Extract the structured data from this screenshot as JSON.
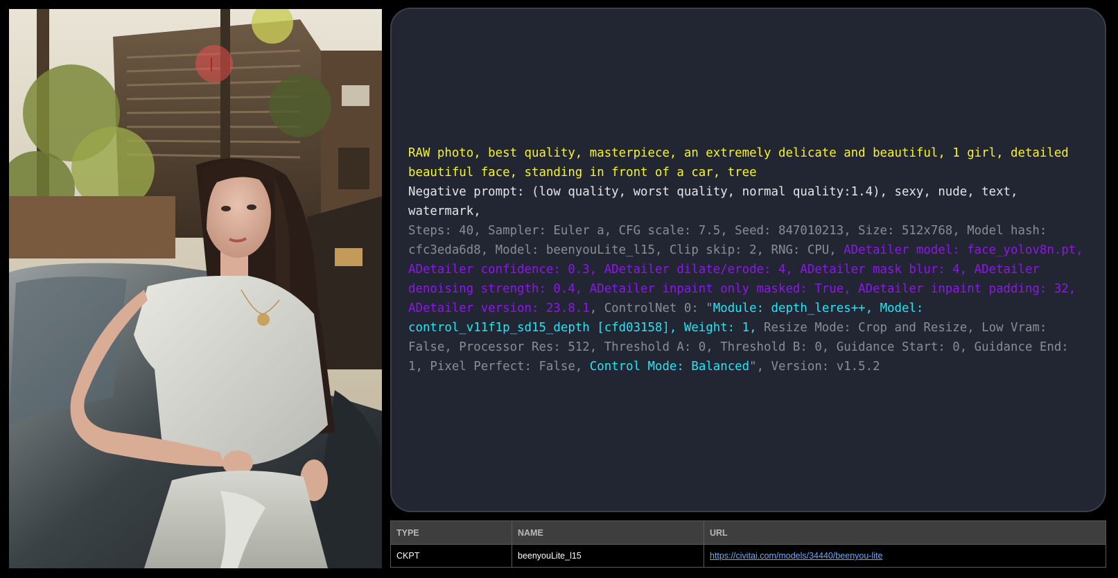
{
  "prompt": {
    "positive": "RAW photo, best quality, masterpiece, an extremely delicate and beautiful, 1 girl, detailed beautiful face, standing in front of a car, tree",
    "negative": "Negative prompt: (low quality, worst quality, normal quality:1.4), sexy, nude, text, watermark,",
    "params": {
      "base": "Steps: 40, Sampler: Euler a, CFG scale: 7.5, Seed: 847010213, Size: 512x768, Model hash: cfc3eda6d8, Model: beenyouLite_l15, Clip skip: 2, RNG: CPU, ",
      "adetailer": "ADetailer model: face_yolov8n.pt, ADetailer confidence: 0.3, ADetailer dilate/erode: 4, ADetailer mask blur: 4, ADetailer denoising strength: 0.4, ADetailer inpaint only masked: True, ADetailer inpaint padding: 32, ADetailer version: 23.8.1",
      "controlnet_prefix": ", ControlNet 0: \"",
      "controlnet_module": "Module: depth_leres++, Model: control_v11f1p_sd15_depth [cfd03158], Weight: 1,",
      "controlnet_settings": " Resize Mode: Crop and Resize, Low Vram: False, Processor Res: 512, Threshold A: 0, Threshold B: 0, Guidance Start: 0, Guidance End: 1, Pixel Perfect: False, ",
      "control_mode": "Control Mode: Balanced",
      "version_suffix": "\", Version: v1.5.2"
    }
  },
  "resources": {
    "headers": {
      "type": "TYPE",
      "name": "NAME",
      "url": "URL"
    },
    "rows": [
      {
        "type": "CKPT",
        "name": "beenyouLite_l15",
        "url": "https://civitai.com/models/34440/beenyou-lite"
      }
    ]
  },
  "colors": {
    "positive": "#f5f52a",
    "negative": "#e4e6ea",
    "params": "#8a8d94",
    "adetailer": "#8f15ee",
    "controlnet": "#22e6f2",
    "panel_bg": "#222632"
  },
  "image": {
    "subject": "generated-portrait-image",
    "marker_icon": "red-cursor-marker-icon"
  }
}
